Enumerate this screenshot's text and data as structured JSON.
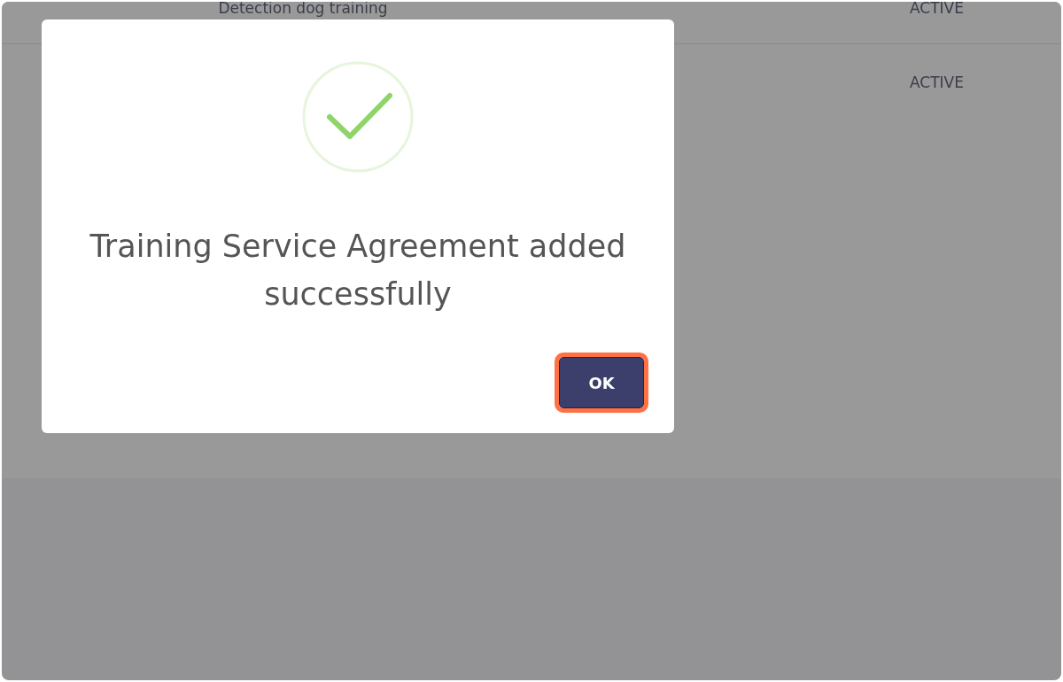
{
  "table": {
    "rows": [
      {
        "name": "Detection dog training",
        "status": "ACTIVE"
      },
      {
        "status": "ACTIVE"
      }
    ]
  },
  "dialog": {
    "kind": "success",
    "message": "Training Service Agreement added successfully",
    "buttons": [
      {
        "label": "OK",
        "focused": true
      }
    ]
  }
}
